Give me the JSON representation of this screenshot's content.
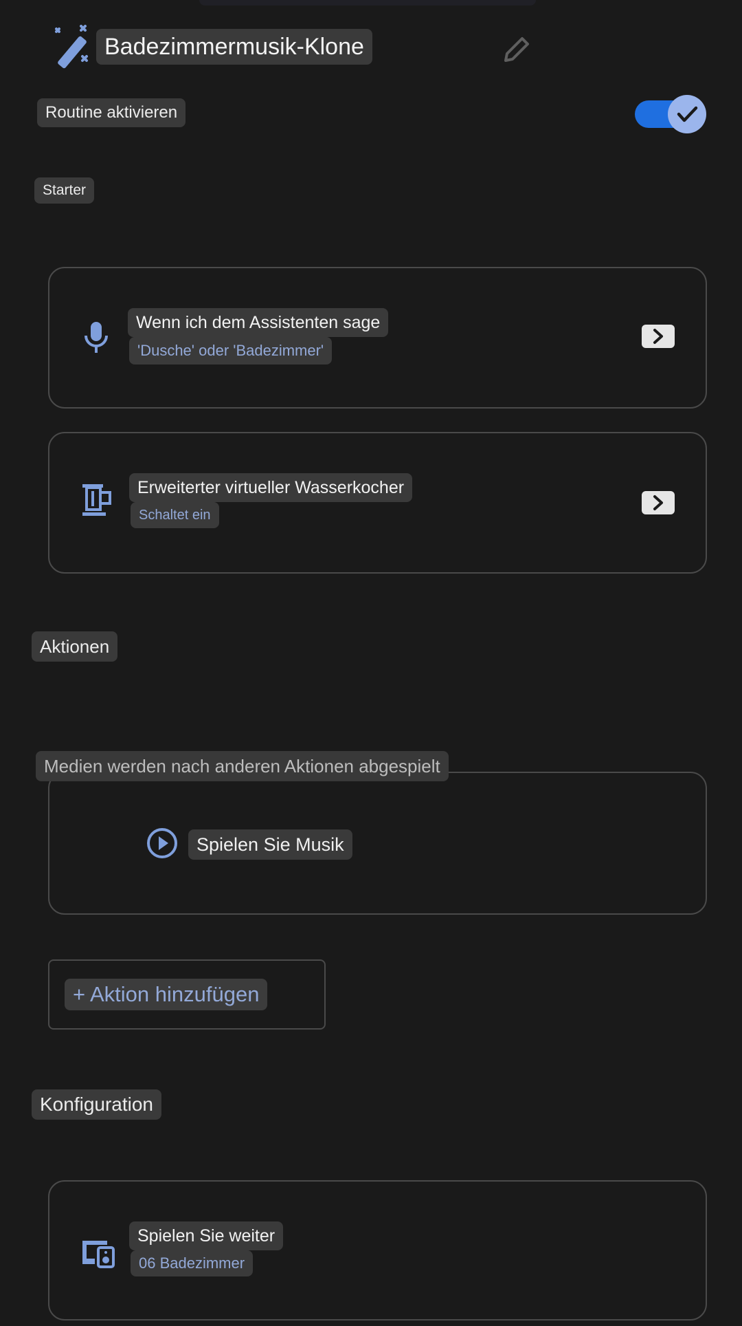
{
  "header": {
    "title": "Badezimmermusik-Klone"
  },
  "enable_routine": {
    "label": "Routine aktivieren",
    "enabled": true
  },
  "starter": {
    "section_label": "Starter",
    "items": [
      {
        "title": "Wenn ich dem Assistenten sage",
        "subtitle": "'Dusche' oder 'Badezimmer'",
        "icon": "microphone-icon"
      },
      {
        "title": "Erweiterter virtueller Wasserkocher",
        "subtitle": "Schaltet ein",
        "icon": "kettle-icon"
      }
    ]
  },
  "actions": {
    "section_label": "Aktionen",
    "media_note": "Medien werden nach anderen Aktionen abgespielt",
    "play_music_label": "Spielen Sie Musik",
    "add_action_label": "+ Aktion hinzufügen"
  },
  "configuration": {
    "section_label": "Konfiguration",
    "item": {
      "title": "Spielen Sie weiter",
      "subtitle": "06 Badezimmer",
      "icon": "speaker-device-icon"
    }
  },
  "colors": {
    "background": "#1a1a1a",
    "accent": "#1f6fe0",
    "icon_blue": "#7f9fdc"
  }
}
